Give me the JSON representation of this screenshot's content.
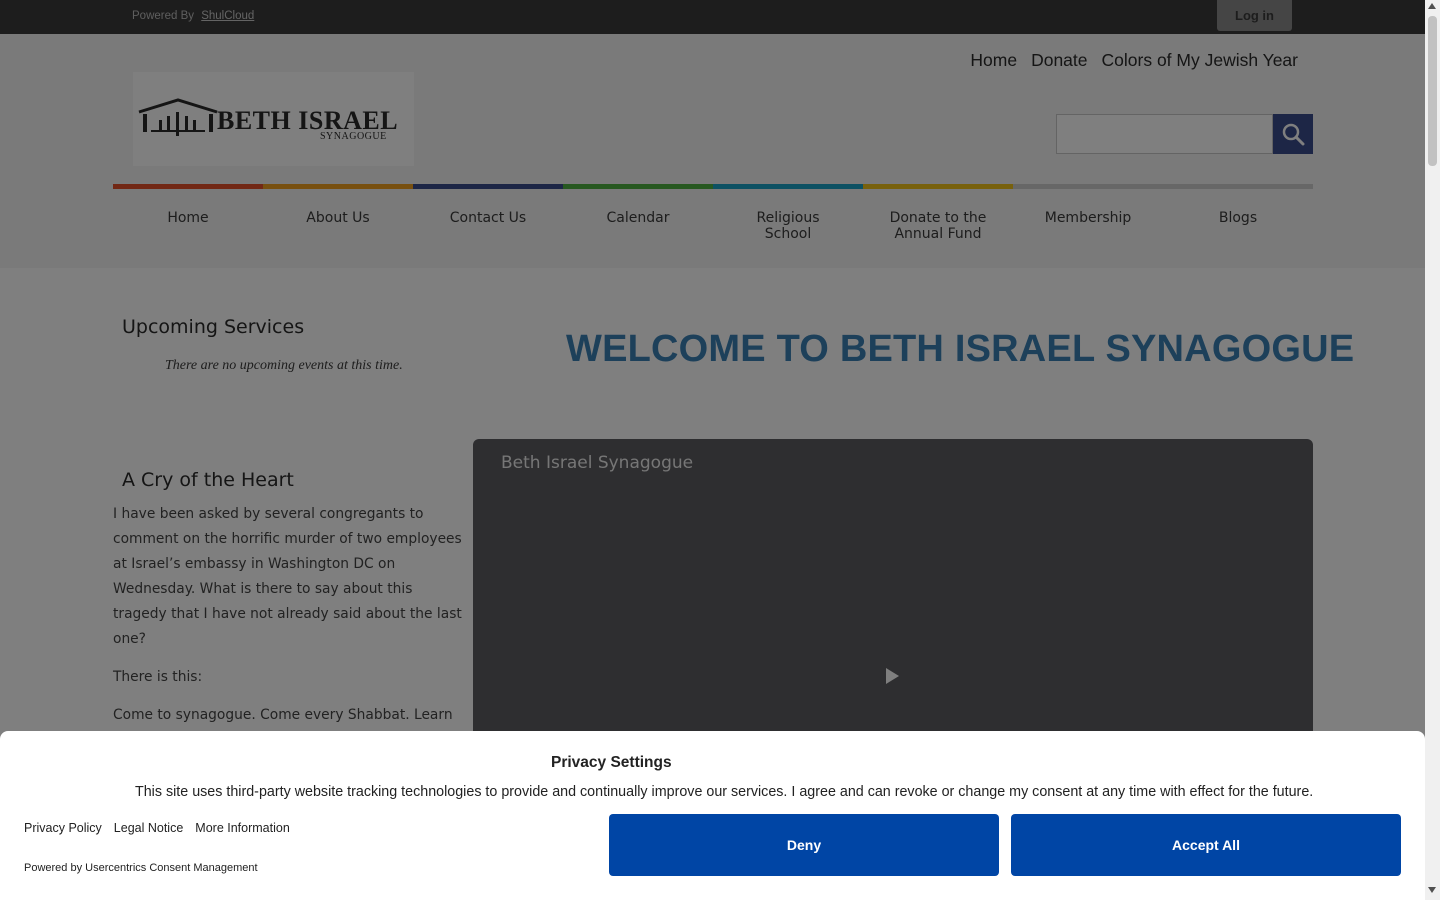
{
  "topbar": {
    "powered_by": "Powered By",
    "powered_link": "ShulCloud",
    "login": "Log in"
  },
  "util_nav": [
    "Home",
    "Donate",
    "Colors of My Jewish Year"
  ],
  "logo": {
    "name": "BETH ISRAEL",
    "sub": "SYNAGOGUE"
  },
  "search": {
    "placeholder": "",
    "icon": "search-icon"
  },
  "color_bar": [
    "#e5502a",
    "#f0a020",
    "#3b4d8c",
    "#4fb040",
    "#1ba3c6",
    "#f1c21b",
    "#cfcfcf",
    "#cfcfcf"
  ],
  "main_nav": [
    "Home",
    "About Us",
    "Contact Us",
    "Calendar",
    "Religious School",
    "Donate to the Annual Fund",
    "Membership",
    "Blogs"
  ],
  "upcoming": {
    "title": "Upcoming Services",
    "empty": "There are no upcoming events at this time."
  },
  "welcome": "WELCOME TO BETH ISRAEL SYNAGOGUE",
  "post": {
    "title": "A Cry of the Heart",
    "paragraphs": [
      "I have been asked by several congregants to comment on the horrific murder of two employees at Israel’s embassy in Washington DC on Wednesday.   What is there to say about this tragedy that I have not already said about the last one?",
      "There is this:",
      "Come to synagogue.  Come every Shabbat.  Learn"
    ]
  },
  "video": {
    "title": "Beth Israel Synagogue"
  },
  "consent": {
    "title": "Privacy Settings",
    "text": "This site uses third-party website tracking technologies to provide and continually improve our services. I agree and can revoke or change my consent at any time with effect for the future.",
    "links": [
      "Privacy Policy",
      "Legal Notice",
      "More Information"
    ],
    "powered": "Powered by Usercentrics Consent Management",
    "deny": "Deny",
    "accept": "Accept All"
  }
}
